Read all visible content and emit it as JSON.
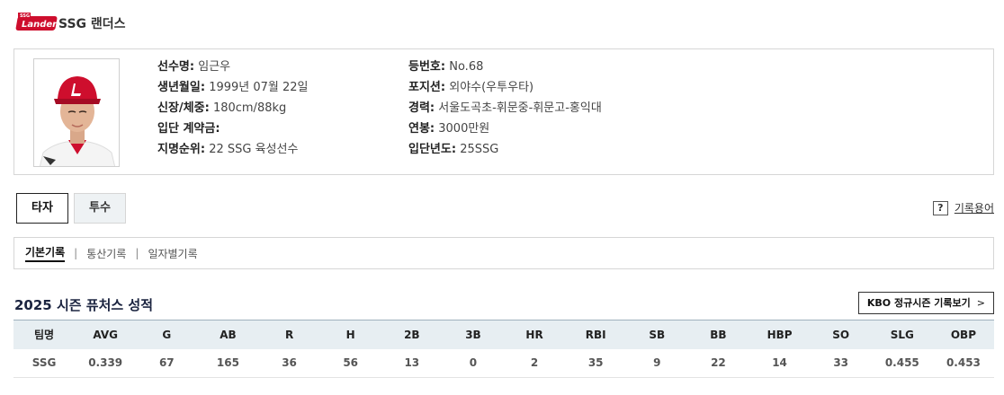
{
  "brand": {
    "logo_text": "Landers",
    "logo_small": "SSG",
    "team_name": "SSG 랜더스",
    "color": "#ce0e2d"
  },
  "profile": {
    "col1": [
      {
        "label": "선수명:",
        "value": "임근우"
      },
      {
        "label": "생년월일:",
        "value": "1999년 07월 22일"
      },
      {
        "label": "신장/체중:",
        "value": "180cm/88kg"
      },
      {
        "label": "입단 계약금:",
        "value": ""
      },
      {
        "label": "지명순위:",
        "value": "22 SSG 육성선수"
      }
    ],
    "col2": [
      {
        "label": "등번호:",
        "value": "No.68"
      },
      {
        "label": "포지션:",
        "value": "외야수(우투우타)"
      },
      {
        "label": "경력:",
        "value": "서울도곡초-휘문중-휘문고-홍익대"
      },
      {
        "label": "연봉:",
        "value": "3000만원"
      },
      {
        "label": "입단년도:",
        "value": "25SSG"
      }
    ]
  },
  "tabs": {
    "batter": "타자",
    "pitcher": "투수"
  },
  "glossary": {
    "icon": "?",
    "label": "기록용어"
  },
  "subtabs": [
    "기본기록",
    "통산기록",
    "일자별기록"
  ],
  "section": {
    "title": "2025 시즌 퓨처스 성적",
    "kbo_button": "KBO 정규시즌 기록보기",
    "kbo_chevron": ">"
  },
  "stats": {
    "headers": [
      "팀명",
      "AVG",
      "G",
      "AB",
      "R",
      "H",
      "2B",
      "3B",
      "HR",
      "RBI",
      "SB",
      "BB",
      "HBP",
      "SO",
      "SLG",
      "OBP"
    ],
    "rows": [
      [
        "SSG",
        "0.339",
        "67",
        "165",
        "36",
        "56",
        "13",
        "0",
        "2",
        "35",
        "9",
        "22",
        "14",
        "33",
        "0.455",
        "0.453"
      ]
    ]
  }
}
